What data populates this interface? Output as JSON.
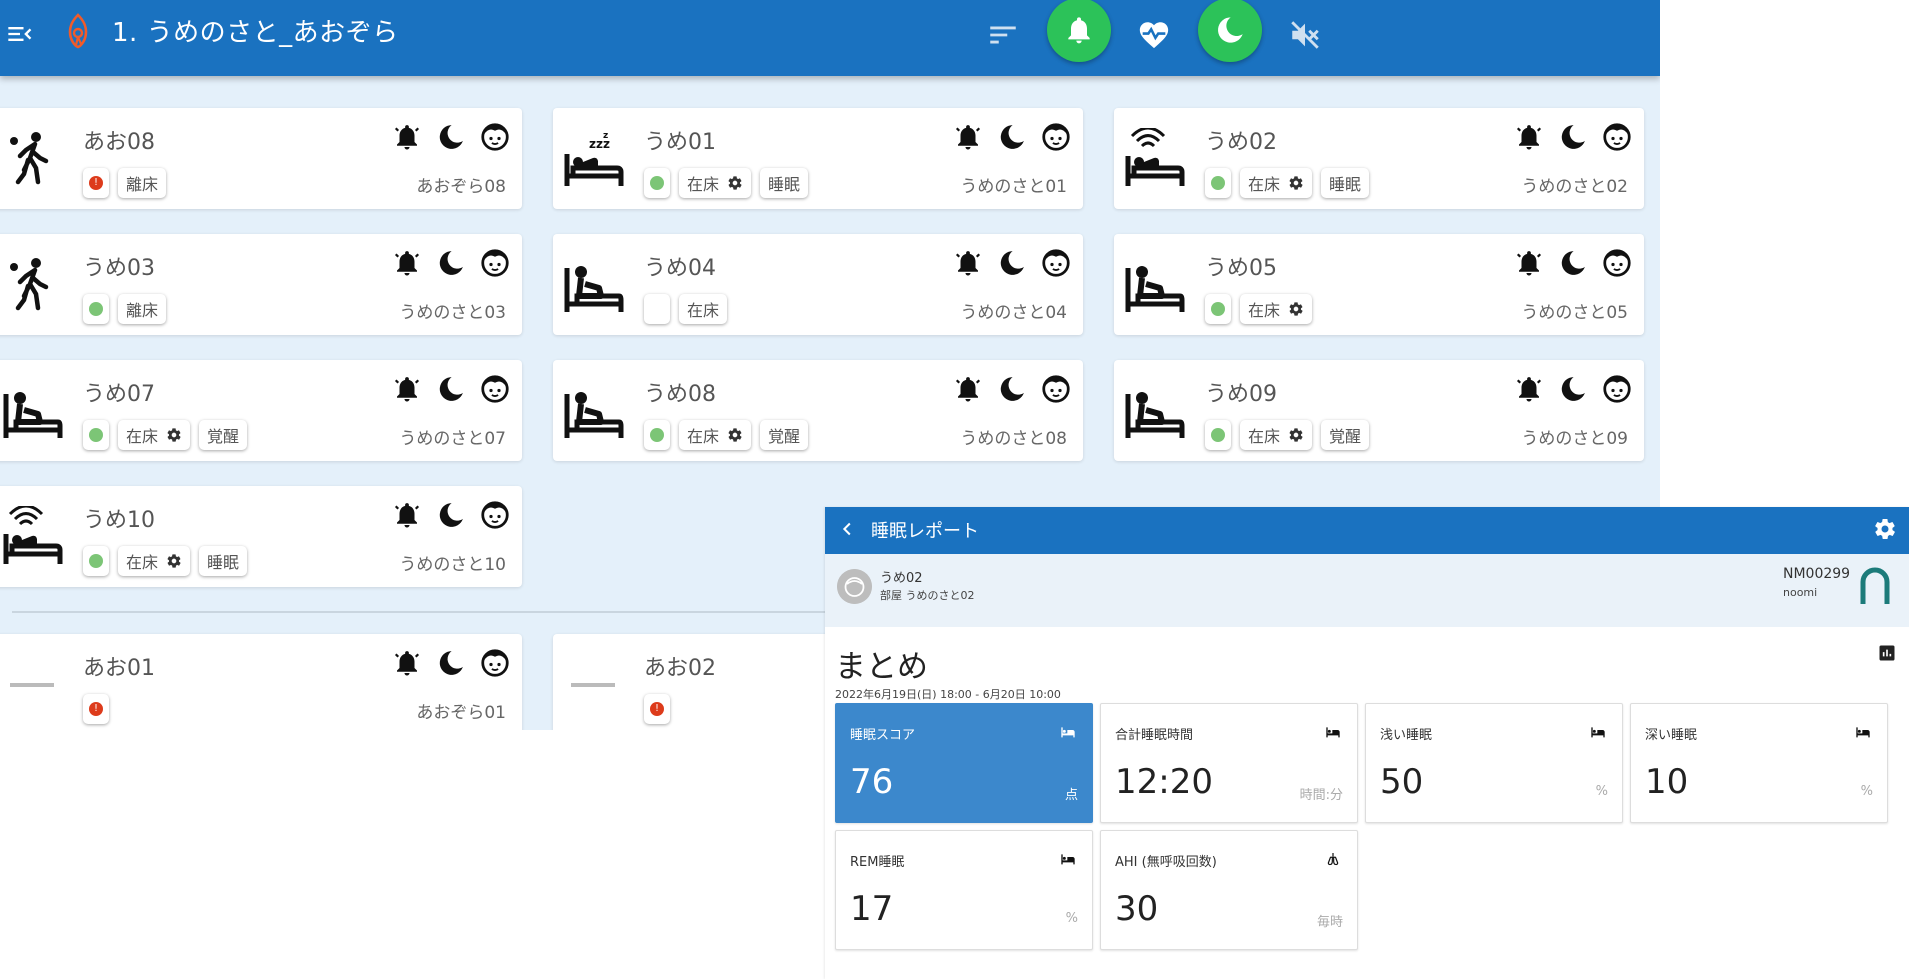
{
  "header": {
    "title": "1. うめのさと_あおぞら",
    "icons": [
      "menu-collapse-icon",
      "app-logo-icon",
      "sort-icon",
      "alarm-bell-icon",
      "heartbeat-icon",
      "moon-icon",
      "sound-off-icon"
    ],
    "accent": "#1a72c0",
    "active_color": "#2cc259"
  },
  "residents": [
    {
      "name": "あお08",
      "room": "あおぞら08",
      "state": "walking",
      "alert": "error",
      "chips": [
        "離床"
      ],
      "chip_gear": false
    },
    {
      "name": "うめ01",
      "room": "うめのさと01",
      "state": "sleeping",
      "alert": "ok",
      "chips": [
        "在床",
        "睡眠"
      ],
      "chip_gear": true
    },
    {
      "name": "うめ02",
      "room": "うめのさと02",
      "state": "bed-signal",
      "alert": "ok",
      "chips": [
        "在床",
        "睡眠"
      ],
      "chip_gear": true
    },
    {
      "name": "うめ03",
      "room": "うめのさと03",
      "state": "walking",
      "alert": "ok",
      "chips": [
        "離床"
      ],
      "chip_gear": false
    },
    {
      "name": "うめ04",
      "room": "うめのさと04",
      "state": "sitting",
      "alert": "none",
      "chips": [
        "在床"
      ],
      "chip_gear": false
    },
    {
      "name": "うめ05",
      "room": "うめのさと05",
      "state": "sitting",
      "alert": "ok",
      "chips": [
        "在床"
      ],
      "chip_gear": true
    },
    {
      "name": "うめ07",
      "room": "うめのさと07",
      "state": "sitting",
      "alert": "ok",
      "chips": [
        "在床",
        "覚醒"
      ],
      "chip_gear": true
    },
    {
      "name": "うめ08",
      "room": "うめのさと08",
      "state": "sitting",
      "alert": "ok",
      "chips": [
        "在床",
        "覚醒"
      ],
      "chip_gear": true
    },
    {
      "name": "うめ09",
      "room": "うめのさと09",
      "state": "sitting",
      "alert": "ok",
      "chips": [
        "在床",
        "覚醒"
      ],
      "chip_gear": true
    },
    {
      "name": "うめ10",
      "room": "うめのさと10",
      "state": "bed-signal",
      "alert": "ok",
      "chips": [
        "在床",
        "睡眠"
      ],
      "chip_gear": true
    },
    {
      "name": "あお01",
      "room": "あおぞら01",
      "state": "none",
      "alert": "error",
      "chips": [],
      "chip_gear": false
    },
    {
      "name": "あお02",
      "room": "",
      "state": "none",
      "alert": "error",
      "chips": [],
      "chip_gear": false
    }
  ],
  "status_colors": {
    "ok": "#7cc576",
    "error": "#dd3b1b"
  },
  "report": {
    "title": "睡眠レポート",
    "subject": {
      "name": "うめ02",
      "room": "部屋 うめのさと02"
    },
    "device": {
      "id": "NM00299",
      "name": "noomi"
    },
    "summary_title": "まとめ",
    "period": "2022年6月19日(日) 18:00 - 6月20日 10:00",
    "metrics": [
      {
        "label": "睡眠スコア",
        "value": "76",
        "unit": "点",
        "icon": "bed-icon",
        "primary": true
      },
      {
        "label": "合計睡眠時間",
        "value": "12:20",
        "unit": "時間:分",
        "icon": "bed-icon",
        "primary": false
      },
      {
        "label": "浅い睡眠",
        "value": "50",
        "unit": "%",
        "icon": "bed-icon",
        "primary": false
      },
      {
        "label": "深い睡眠",
        "value": "10",
        "unit": "%",
        "icon": "bed-icon",
        "primary": false
      },
      {
        "label": "REM睡眠",
        "value": "17",
        "unit": "%",
        "icon": "bed-icon",
        "primary": false
      },
      {
        "label": "AHI (無呼吸回数)",
        "value": "30",
        "unit": "毎時",
        "icon": "lungs-icon",
        "primary": false
      }
    ]
  }
}
